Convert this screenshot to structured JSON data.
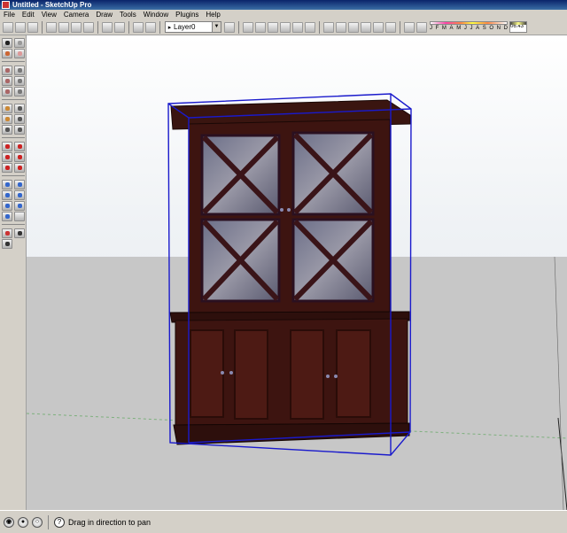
{
  "window": {
    "title": "Untitled - SketchUp Pro"
  },
  "menu": {
    "items": [
      "File",
      "Edit",
      "View",
      "Camera",
      "Draw",
      "Tools",
      "Window",
      "Plugins",
      "Help"
    ]
  },
  "layer": {
    "current": "Layer0"
  },
  "shadow": {
    "months": [
      "J",
      "F",
      "M",
      "A",
      "M",
      "J",
      "J",
      "A",
      "S",
      "O",
      "N",
      "D"
    ],
    "time": "06:43"
  },
  "status": {
    "text": "Drag in direction to pan"
  },
  "colors": {
    "cabinet": "#3d1410",
    "selection": "#1a1acc",
    "title_bar": "#0a246a"
  }
}
